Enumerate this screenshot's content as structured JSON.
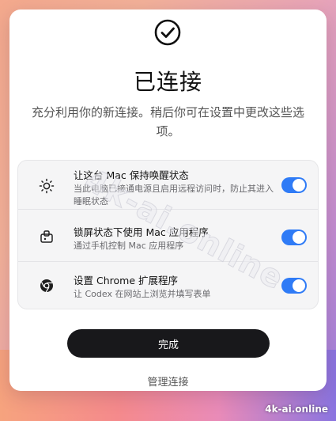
{
  "dialog": {
    "title": "已连接",
    "subtitle": "充分利用你的新连接。稍后你可在设置中更改这些选项。"
  },
  "settings": [
    {
      "label": "让这台 Mac 保持唤醒状态",
      "description": "当此电脑已接通电源且启用远程访问时，防止其进入睡眠状态",
      "icon": "sun-icon",
      "enabled": true
    },
    {
      "label": "锁屏状态下使用 Mac 应用程序",
      "description": "通过手机控制 Mac 应用程序",
      "icon": "lock-screen-icon",
      "enabled": true
    },
    {
      "label": "设置 Chrome 扩展程序",
      "description": "让 Codex 在网站上浏览并填写表单",
      "icon": "chrome-icon",
      "enabled": true
    }
  ],
  "buttons": {
    "done": "完成",
    "manage": "管理连接"
  },
  "watermark": {
    "center": "4k-ai.online",
    "corner": "4k-ai.online"
  },
  "colors": {
    "toggle_on": "#2f7bf6",
    "button_bg": "#18181b"
  }
}
